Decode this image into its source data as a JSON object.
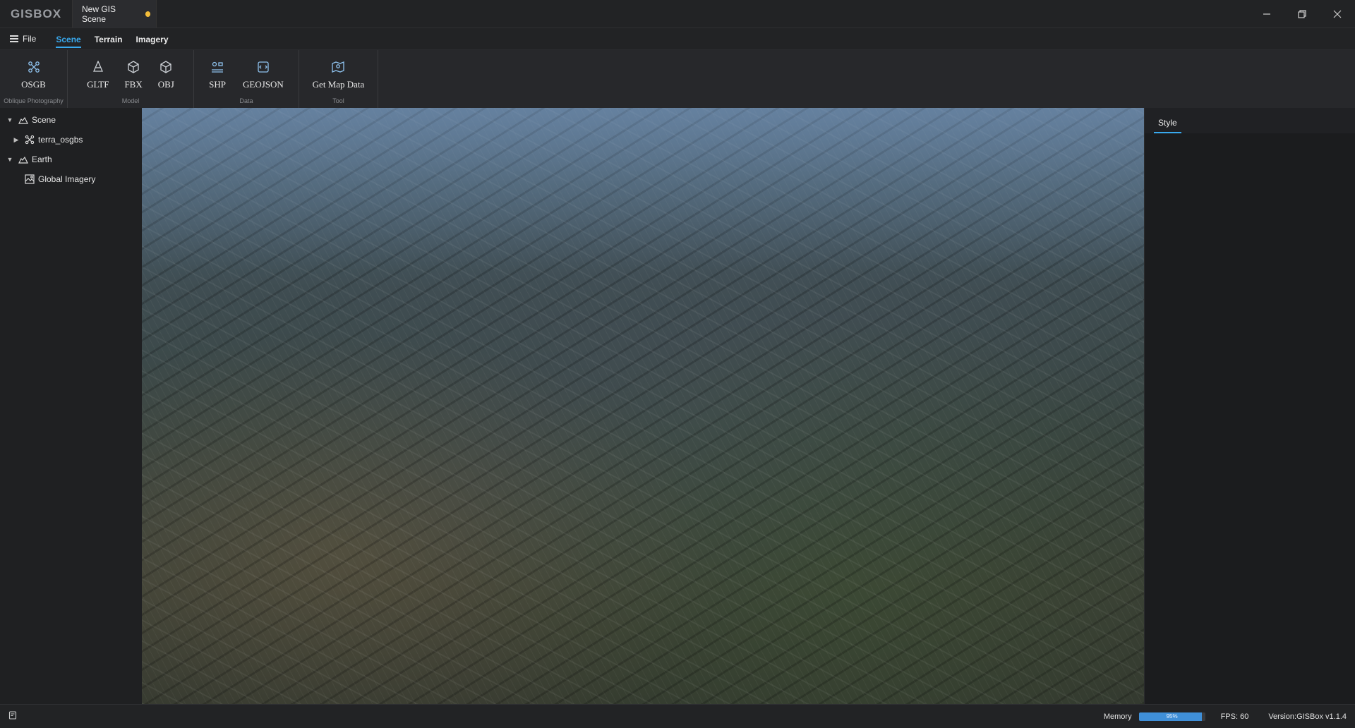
{
  "app": {
    "logo_text": "GISBOX",
    "document_tab": "New GIS Scene",
    "unsaved_indicator_color": "#f3bd3a"
  },
  "window_controls": [
    "minimize-icon",
    "restore-icon",
    "close-icon"
  ],
  "menu": {
    "file_label": "File",
    "tabs": [
      {
        "label": "Scene",
        "active": true
      },
      {
        "label": "Terrain",
        "active": false
      },
      {
        "label": "Imagery",
        "active": false
      }
    ]
  },
  "ribbon": {
    "groups": [
      {
        "label": "Oblique Photography",
        "buttons": [
          {
            "label": "OSGB",
            "icon": "osgb-icon"
          }
        ]
      },
      {
        "label": "Model",
        "buttons": [
          {
            "label": "GLTF",
            "icon": "gltf-icon"
          },
          {
            "label": "FBX",
            "icon": "fbx-icon"
          },
          {
            "label": "OBJ",
            "icon": "obj-icon"
          }
        ]
      },
      {
        "label": "Data",
        "buttons": [
          {
            "label": "SHP",
            "icon": "shp-icon"
          },
          {
            "label": "GEOJSON",
            "icon": "geojson-icon"
          }
        ]
      },
      {
        "label": "Tool",
        "buttons": [
          {
            "label": "Get Map Data",
            "icon": "map-data-icon"
          }
        ]
      }
    ]
  },
  "tree": [
    {
      "label": "Scene",
      "icon": "layer-icon",
      "expanded": true,
      "level": 0
    },
    {
      "label": "terra_osgbs",
      "icon": "osgb-icon",
      "expanded": false,
      "level": 1
    },
    {
      "label": "Earth",
      "icon": "layer-icon",
      "expanded": true,
      "level": 0
    },
    {
      "label": "Global Imagery",
      "icon": "imagery-icon",
      "level": 1
    }
  ],
  "viewport": {
    "content": "aerial-city-imagery"
  },
  "right_panel": {
    "tab": "Style"
  },
  "status": {
    "memory_label": "Memory",
    "memory_percent_text": "95%",
    "memory_fraction": 0.95,
    "fps_text": "FPS: 60",
    "version_text": "Version:GISBox v1.1.4"
  },
  "colors": {
    "accent": "#39a9ee",
    "memory_bar": "#3f8fd8"
  }
}
